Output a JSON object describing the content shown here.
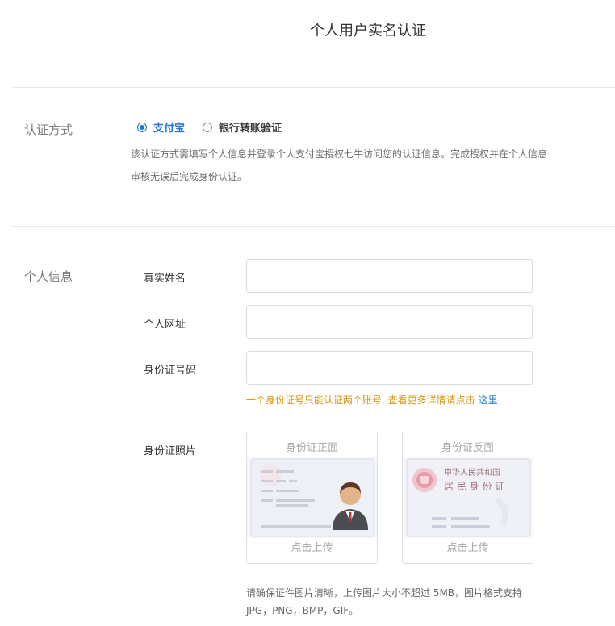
{
  "page": {
    "title": "个人用户实名认证"
  },
  "auth_method": {
    "section_label": "认证方式",
    "options": [
      {
        "label": "支付宝",
        "selected": true
      },
      {
        "label": "银行转账验证",
        "selected": false
      }
    ],
    "description": "该认证方式需填写个人信息并登录个人支付宝授权七牛访问您的认证信息。完成授权并在个人信息审核无误后完成身份认证。"
  },
  "personal_info": {
    "section_label": "个人信息",
    "fields": [
      {
        "label": "真实姓名",
        "value": "",
        "placeholder": ""
      },
      {
        "label": "个人网址",
        "value": "",
        "placeholder": ""
      },
      {
        "label": "身份证号码",
        "value": "",
        "placeholder": ""
      }
    ],
    "hint_text": "一个身份证号只能认证两个账号, 查看更多详情请点击",
    "hint_link": "这里",
    "photo_label": "身份证照片",
    "upload_boxes": [
      {
        "title": "身份证正面",
        "action": "点击上传"
      },
      {
        "title": "身份证反面",
        "action": "点击上传"
      }
    ],
    "id_card_back_text_line1": "中华人民共和国",
    "id_card_back_text_line2": "居 民 身 份 证",
    "note_line1": "请确保证件图片清晰，上传图片大小不超过 5MB，图片格式支持",
    "note_line2": "JPG，PNG，BMP，GIF。"
  },
  "colors": {
    "accent": "#1f74d6",
    "hint": "#d89612",
    "link": "#2e86de"
  }
}
